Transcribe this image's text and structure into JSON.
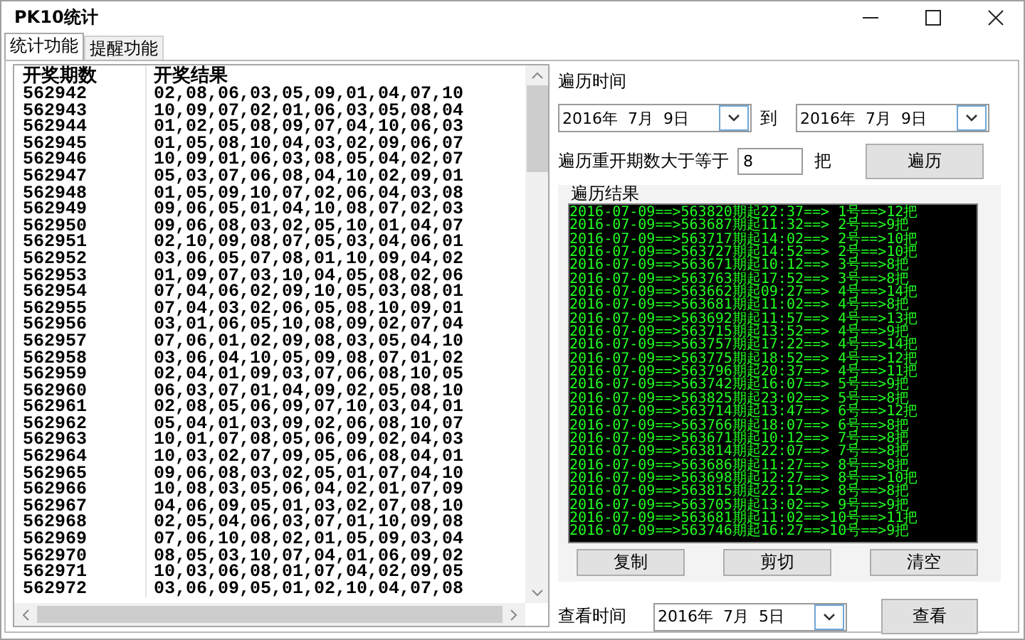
{
  "window": {
    "title": "PK10统计"
  },
  "tabs": [
    {
      "label": "统计功能",
      "selected": true
    },
    {
      "label": "提醒功能",
      "selected": false
    }
  ],
  "table": {
    "columns": [
      "开奖期数",
      "开奖结果"
    ],
    "rows": [
      [
        "562942",
        "02,08,06,03,05,09,01,04,07,10"
      ],
      [
        "562943",
        "10,09,07,02,01,06,03,05,08,04"
      ],
      [
        "562944",
        "01,02,05,08,09,07,04,10,06,03"
      ],
      [
        "562945",
        "01,05,08,10,04,03,02,09,06,07"
      ],
      [
        "562946",
        "10,09,01,06,03,08,05,04,02,07"
      ],
      [
        "562947",
        "05,03,07,06,08,04,10,02,09,01"
      ],
      [
        "562948",
        "01,05,09,10,07,02,06,04,03,08"
      ],
      [
        "562949",
        "09,06,05,01,04,10,08,07,02,03"
      ],
      [
        "562950",
        "09,06,08,03,02,05,10,01,04,07"
      ],
      [
        "562951",
        "02,10,09,08,07,05,03,04,06,01"
      ],
      [
        "562952",
        "03,06,05,07,08,01,10,09,04,02"
      ],
      [
        "562953",
        "01,09,07,03,10,04,05,08,02,06"
      ],
      [
        "562954",
        "07,04,06,02,09,10,05,03,08,01"
      ],
      [
        "562955",
        "07,04,03,02,06,05,08,10,09,01"
      ],
      [
        "562956",
        "03,01,06,05,10,08,09,02,07,04"
      ],
      [
        "562957",
        "07,06,01,02,09,08,03,05,04,10"
      ],
      [
        "562958",
        "03,06,04,10,05,09,08,07,01,02"
      ],
      [
        "562959",
        "02,04,01,09,03,07,06,08,10,05"
      ],
      [
        "562960",
        "06,03,07,01,04,09,02,05,08,10"
      ],
      [
        "562961",
        "02,08,05,06,09,07,10,03,04,01"
      ],
      [
        "562962",
        "05,04,01,03,09,02,06,08,10,07"
      ],
      [
        "562963",
        "10,01,07,08,05,06,09,02,04,03"
      ],
      [
        "562964",
        "10,03,02,07,09,05,06,08,04,01"
      ],
      [
        "562965",
        "09,06,08,03,02,05,01,07,04,10"
      ],
      [
        "562966",
        "10,08,03,05,06,04,02,01,07,09"
      ],
      [
        "562967",
        "04,06,09,05,01,03,02,07,08,10"
      ],
      [
        "562968",
        "02,05,04,06,03,07,01,10,09,08"
      ],
      [
        "562969",
        "07,06,10,08,02,01,05,09,03,04"
      ],
      [
        "562970",
        "08,05,03,10,07,04,01,06,09,02"
      ],
      [
        "562971",
        "10,03,06,08,01,07,04,02,09,05"
      ],
      [
        "562972",
        "03,06,09,05,01,02,10,04,07,08"
      ]
    ]
  },
  "traverse": {
    "time_label": "遍历时间",
    "start_date": "2016年  7月  9日",
    "to_label": "到",
    "end_date": "2016年  7月  9日",
    "threshold_label": "遍历重开期数大于等于",
    "threshold_value": "8",
    "unit_label": "把",
    "button": "遍历"
  },
  "results": {
    "title": "遍历结果",
    "lines": [
      "2016-07-09==>563820期起22:37==> 1号==>12把",
      "2016-07-09==>563687期起11:32==> 2号==>9把",
      "2016-07-09==>563717期起14:02==> 2号==>10把",
      "2016-07-09==>563727期起14:52==> 2号==>10把",
      "2016-07-09==>563671期起10:12==> 3号==>8把",
      "2016-07-09==>563763期起17:52==> 3号==>8把",
      "2016-07-09==>563662期起09:27==> 4号==>14把",
      "2016-07-09==>563681期起11:02==> 4号==>8把",
      "2016-07-09==>563692期起11:57==> 4号==>13把",
      "2016-07-09==>563715期起13:52==> 4号==>9把",
      "2016-07-09==>563757期起17:22==> 4号==>14把",
      "2016-07-09==>563775期起18:52==> 4号==>12把",
      "2016-07-09==>563796期起20:37==> 4号==>11把",
      "2016-07-09==>563742期起16:07==> 5号==>9把",
      "2016-07-09==>563825期起23:02==> 5号==>8把",
      "2016-07-09==>563714期起13:47==> 6号==>12把",
      "2016-07-09==>563766期起18:07==> 6号==>8把",
      "2016-07-09==>563671期起10:12==> 7号==>8把",
      "2016-07-09==>563814期起22:07==> 7号==>8把",
      "2016-07-09==>563686期起11:27==> 8号==>8把",
      "2016-07-09==>563698期起12:27==> 8号==>10把",
      "2016-07-09==>563815期起22:12==> 8号==>8把",
      "2016-07-09==>563705期起13:02==> 9号==>9把",
      "2016-07-09==>563681期起11:02==>10号==>11把",
      "2016-07-09==>563746期起16:27==>10号==>9把"
    ],
    "buttons": [
      "复制",
      "剪切",
      "清空"
    ]
  },
  "view": {
    "label": "查看时间",
    "date": "2016年  7月  5日",
    "button": "查看"
  }
}
